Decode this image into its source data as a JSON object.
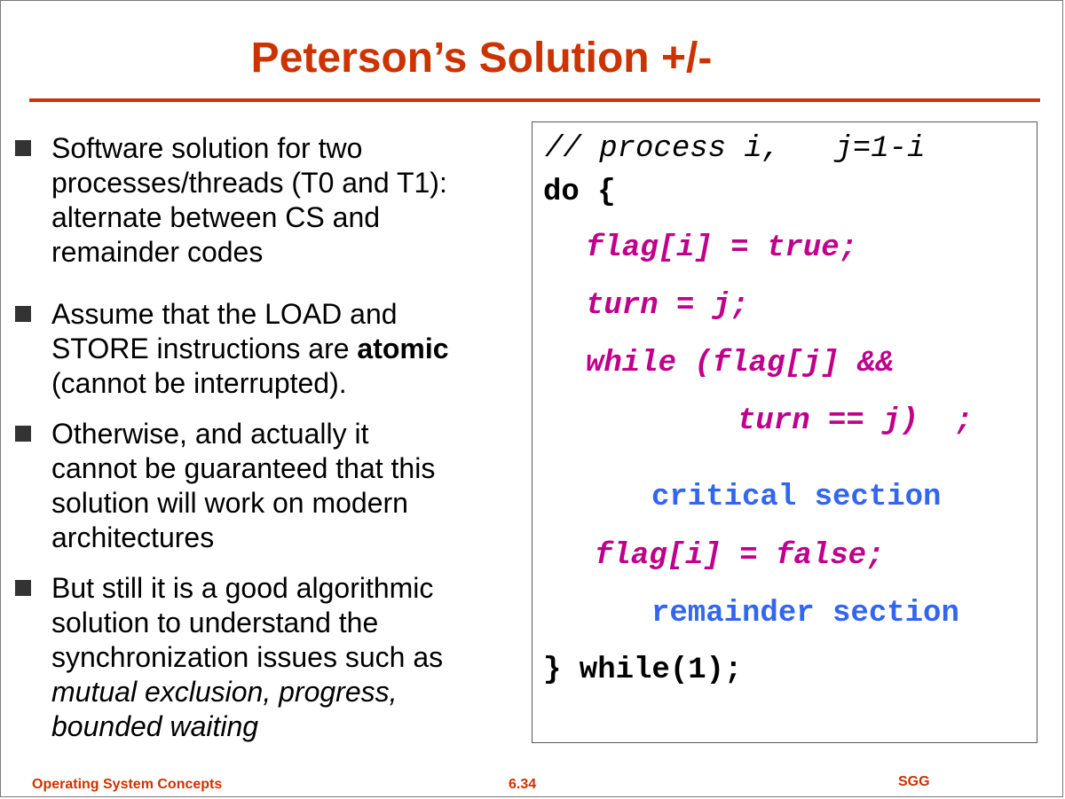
{
  "slide": {
    "title": "Peterson’s Solution +/-",
    "colors": {
      "accent": "#cc3300",
      "code_magenta": "#c0008c",
      "code_blue": "#3366ee"
    }
  },
  "bullets": [
    {
      "lines": [
        "Software solution for two",
        "processes/threads (T0 and T1):",
        "alternate between CS and",
        "remainder codes"
      ]
    },
    {
      "line1": "Assume that the LOAD and",
      "line2_pre": "STORE instructions are ",
      "line2_bold": "atomic",
      "line3": "(cannot be interrupted)."
    },
    {
      "lines": [
        "Otherwise, and actually it",
        "cannot be guaranteed that this",
        "solution will work on modern",
        "architectures"
      ]
    },
    {
      "lines": [
        "But still it is a good algorithmic",
        "solution to understand the",
        "synchronization issues such as"
      ],
      "italic_lines": [
        "mutual exclusion, progress,",
        "bounded waiting"
      ]
    }
  ],
  "code": {
    "comment": "// process i,   j=1-i",
    "do_open": "do {",
    "flag_true": "flag[i] = true;",
    "turn_assign": "turn = j;",
    "while_head": "while (flag[j] &&",
    "while_tail": "turn == j)  ;",
    "critical": "critical section",
    "flag_false": "flag[i] = false;",
    "remainder": "remainder section",
    "close": "} while(1);"
  },
  "footer": {
    "left": "Operating System Concepts",
    "center": "6.34",
    "right": "SGG"
  }
}
